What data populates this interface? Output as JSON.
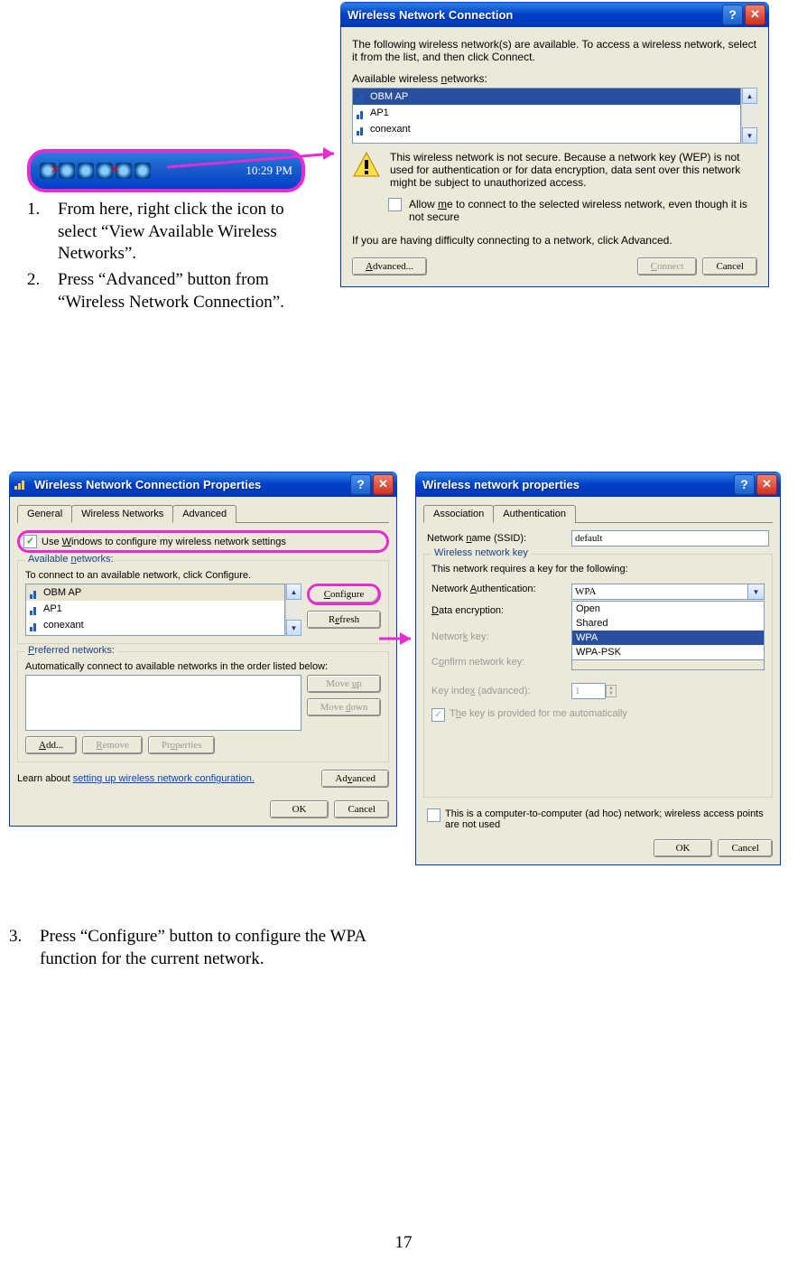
{
  "page_number": "17",
  "tray": {
    "time": "10:29 PM"
  },
  "steps": {
    "s1": "From here, right click the icon to select “View Available Wireless Networks”.",
    "s2": "Press “Advanced” button from “Wireless Network Connection”.",
    "s3": "Press “Configure” button to configure the WPA function for the current network."
  },
  "dlg1": {
    "title": "Wireless Network Connection",
    "intro": "The following wireless network(s) are available. To access a wireless network, select it from the list, and then click Connect.",
    "avail_label": "Available wireless networks:",
    "networks": [
      "OBM AP",
      "AP1",
      "conexant"
    ],
    "warn": "This wireless network is not secure. Because a network key (WEP) is not used for authentication or for data encryption, data sent over this network might be subject to unauthorized access.",
    "allow": "Allow me to connect to the selected wireless network, even though it is not secure",
    "difficulty": "If you are having difficulty connecting to a network, click Advanced.",
    "btn_advanced": "Advanced...",
    "btn_connect": "Connect",
    "btn_cancel": "Cancel"
  },
  "dlg2": {
    "title": "Wireless Network Connection Properties",
    "tabs": [
      "General",
      "Wireless Networks",
      "Advanced"
    ],
    "use_windows": "Use Windows to configure my wireless network settings",
    "avail_legend": "Available networks:",
    "avail_hint": "To connect to an available network, click Configure.",
    "networks": [
      "OBM AP",
      "AP1",
      "conexant"
    ],
    "btn_configure": "Configure",
    "btn_refresh": "Refresh",
    "pref_legend": "Preferred networks:",
    "pref_hint": "Automatically connect to available networks in the order listed below:",
    "btn_moveup": "Move up",
    "btn_movedown": "Move down",
    "btn_add": "Add...",
    "btn_remove": "Remove",
    "btn_properties": "Properties",
    "learn": "Learn about ",
    "learn_link": "setting up wireless network configuration.",
    "btn_advanced": "Advanced",
    "btn_ok": "OK",
    "btn_cancel": "Cancel"
  },
  "dlg3": {
    "title": "Wireless network properties",
    "tabs": [
      "Association",
      "Authentication"
    ],
    "ssid_label": "Network name (SSID):",
    "ssid_value": "default",
    "key_legend": "Wireless network key",
    "key_hint": "This network requires a key for the following:",
    "auth_label": "Network Authentication:",
    "auth_value": "WPA",
    "auth_options": [
      "Open",
      "Shared",
      "WPA",
      "WPA-PSK"
    ],
    "enc_label": "Data encryption:",
    "key_label": "Network key:",
    "confirm_label": "Confirm network key:",
    "idx_label": "Key index (advanced):",
    "idx_value": "1",
    "auto_key": "The key is provided for me automatically",
    "adhoc": "This is a computer-to-computer (ad hoc) network; wireless access points are not used",
    "btn_ok": "OK",
    "btn_cancel": "Cancel"
  }
}
